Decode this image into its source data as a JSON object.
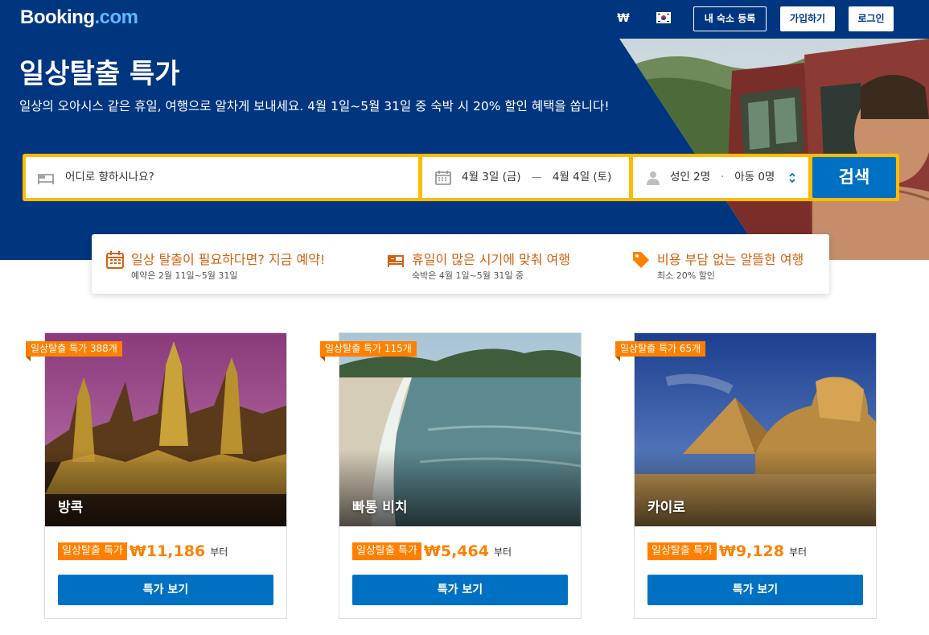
{
  "header": {
    "logo_main": "Booking",
    "logo_dot": ".com",
    "currency": "₩",
    "flag_icon": "kr-flag-icon",
    "list_property_label": "내 숙소 등록",
    "register_label": "가입하기",
    "signin_label": "로그인"
  },
  "hero": {
    "title": "일상탈출 특가",
    "subtitle": "일상의 오아시스 같은 휴일, 여행으로 알차게 보내세요. 4월 1일~5월 31일 중 숙박 시 20% 할인 혜택을 쏩니다!"
  },
  "search": {
    "destination_placeholder": "어디로 향하시나요?",
    "checkin": "4월 3일 (금)",
    "date_separator": "—",
    "checkout": "4월 4일 (토)",
    "adults": "성인 2명",
    "guest_separator": "·",
    "children": "아동 0명",
    "button_label": "검색"
  },
  "benefits": [
    {
      "icon": "calendar-icon",
      "title": "일상 탈출이 필요하다면? 지금 예약!",
      "subtitle": "예약은 2월 11일~5월 31일"
    },
    {
      "icon": "bed-icon",
      "title": "휴일이 많은 시기에 맞춰 여행",
      "subtitle": "숙박은 4월 1일~5월 31일 중"
    },
    {
      "icon": "tag-icon",
      "title": "비용 부담 없는 알뜰한 여행",
      "subtitle": "최소 20% 할인"
    }
  ],
  "cards": [
    {
      "city": "방콕",
      "ribbon": "일상탈출 특가 388개",
      "badge": "일상탈출 특가",
      "price": "₩11,186",
      "from": "부터",
      "button": "특가 보기"
    },
    {
      "city": "빠통 비치",
      "ribbon": "일상탈출 특가 115개",
      "badge": "일상탈출 특가",
      "price": "₩5,464",
      "from": "부터",
      "button": "특가 보기"
    },
    {
      "city": "카이로",
      "ribbon": "일상탈출 특가 65개",
      "badge": "일상탈출 특가",
      "price": "₩9,128",
      "from": "부터",
      "button": "특가 보기"
    }
  ],
  "colors": {
    "brand_navy": "#003580",
    "search_yellow": "#febb02",
    "action_blue": "#0071c2",
    "deal_orange": "#ff8000",
    "benefit_orange": "#d4600e"
  }
}
